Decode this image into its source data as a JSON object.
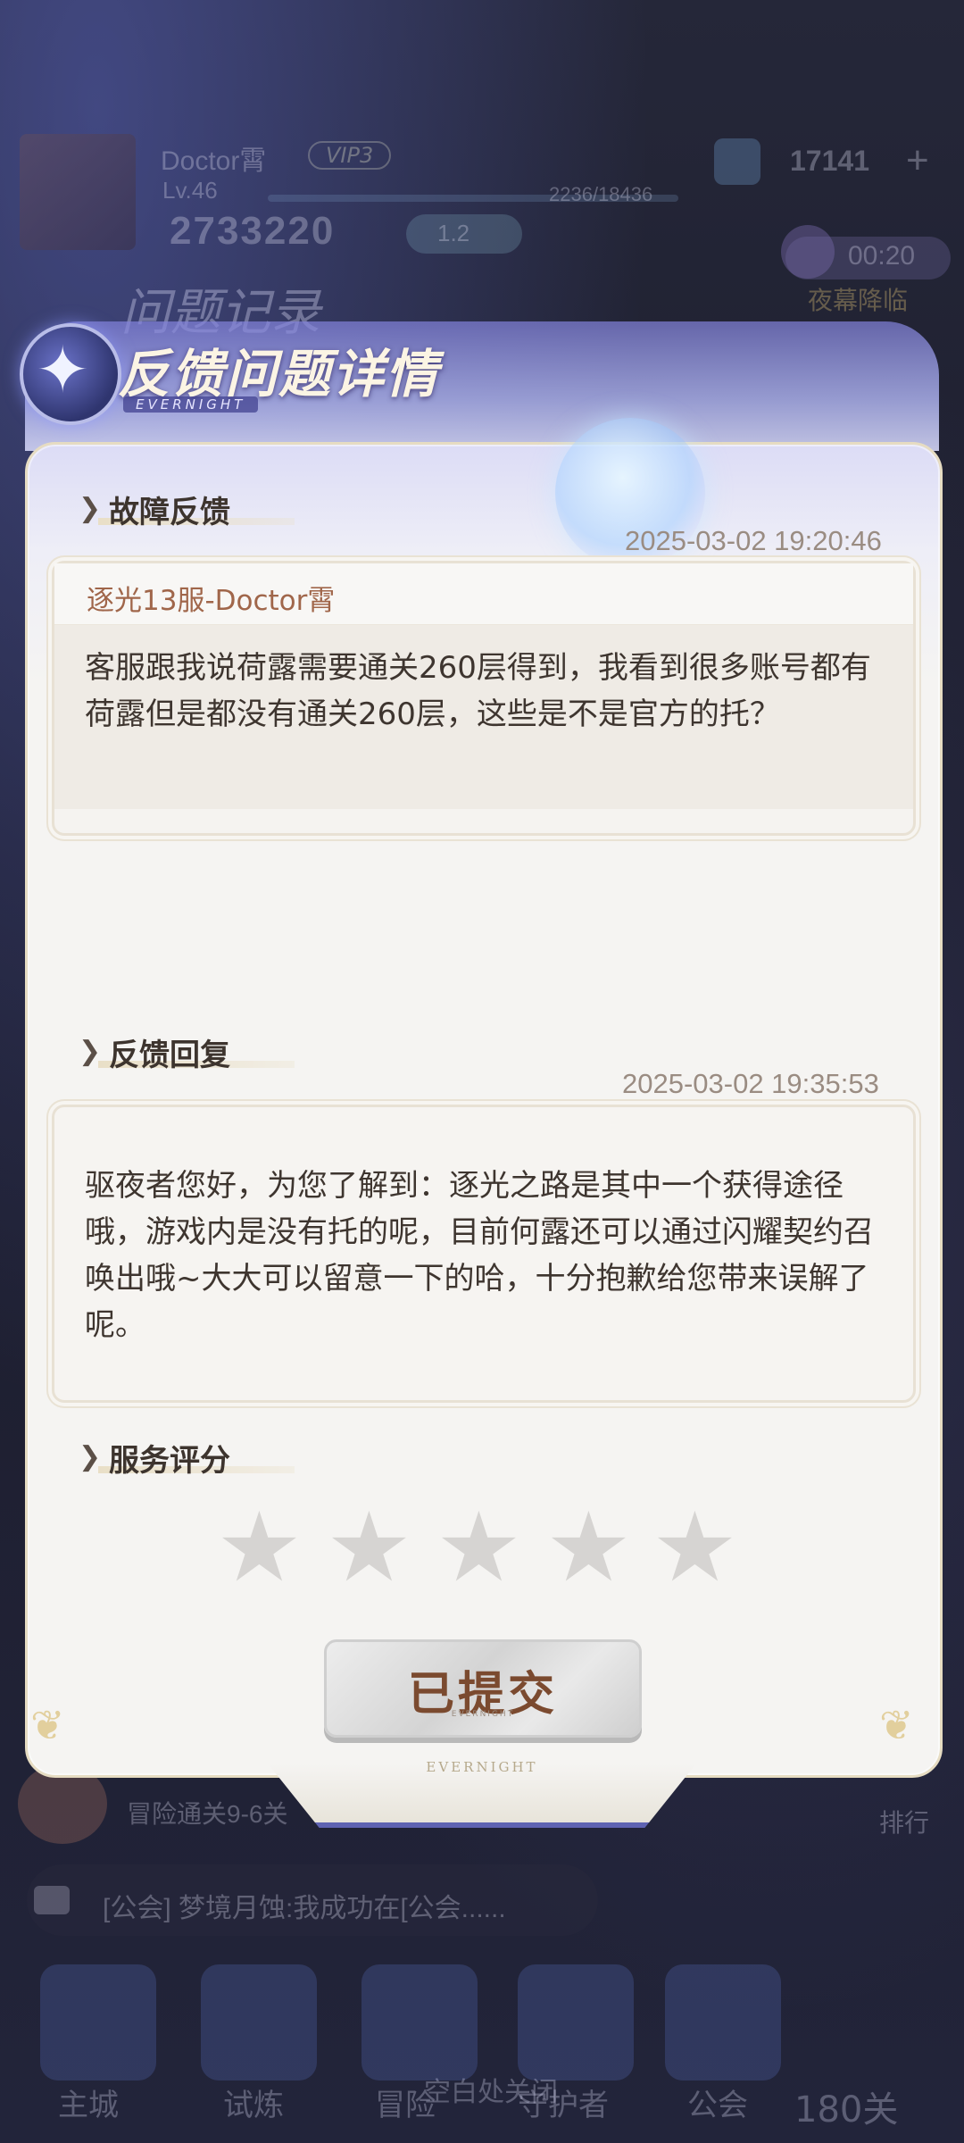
{
  "background": {
    "player_name": "Doctor霄",
    "vip": "VIP3",
    "level": "Lv.46",
    "exp": "2236/18436",
    "gold": "2733220",
    "gold_badge": "1.2",
    "gems": "17141",
    "plus": "+",
    "timer": "00:20",
    "event_name": "夜幕降临",
    "record_title": "问题记录",
    "quest_text": "冒险通关9-6关",
    "rank_label": "排行",
    "chat_text": "[公会] 梦境月蚀:我成功在[公会......",
    "nav": [
      "主城",
      "试炼",
      "冒险",
      "守护者",
      "公会"
    ],
    "nav_overlay": "空白处关闭",
    "stage": "180关"
  },
  "panel": {
    "title": "反馈问题详情",
    "subtitle": "EVERNIGHT",
    "footer": "EVERNIGHT"
  },
  "fault": {
    "heading": "故障反馈",
    "timestamp": "2025-03-02 19:20:46",
    "server": "逐光13服-Doctor霄",
    "content": "客服跟我说荷露需要通关260层得到，我看到很多账号都有荷露但是都没有通关260层，这些是不是官方的托？"
  },
  "reply": {
    "heading": "反馈回复",
    "timestamp": "2025-03-02 19:35:53",
    "content": "驱夜者您好，为您了解到：逐光之路是其中一个获得途径哦，游戏内是没有托的呢，目前何露还可以通过闪耀契约召唤出哦~大大可以留意一下的哈，十分抱歉给您带来误解了呢。"
  },
  "rating": {
    "heading": "服务评分",
    "stars_total": 5,
    "stars_selected": 0
  },
  "submit": {
    "label": "已提交",
    "sub": "EVERNIGHT"
  },
  "colors": {
    "panel_bg": "#f5f4f2",
    "accent_purple": "#5f63b2",
    "text_dark": "#3e352f",
    "server_brown": "#a0664a",
    "timestamp": "#9a8c82",
    "star_empty": "#d6d4d2"
  }
}
